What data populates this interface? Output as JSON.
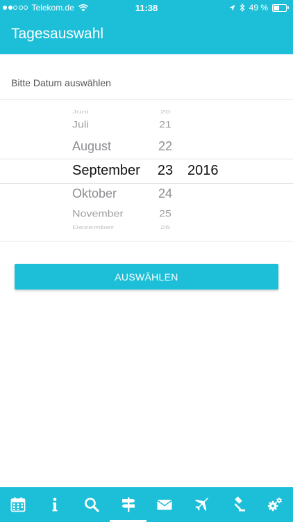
{
  "status_bar": {
    "carrier": "Telekom.de",
    "time": "11:38",
    "battery_text": "49 %",
    "battery_level": 0.49,
    "signal_strength": 2,
    "signal_max": 5
  },
  "nav": {
    "title": "Tagesauswahl"
  },
  "prompt": "Bitte Datum auswählen",
  "picker": {
    "months": [
      "Juni",
      "Juli",
      "August",
      "September",
      "Oktober",
      "November",
      "Dezember"
    ],
    "days": [
      "20",
      "21",
      "22",
      "23",
      "24",
      "25",
      "26"
    ],
    "year": "2016",
    "selected": {
      "month": "September",
      "day": "23",
      "year": "2016"
    }
  },
  "select_button": {
    "label": "AUSWÄHLEN"
  },
  "tab_bar": {
    "tabs": [
      {
        "icon": "calendar-icon",
        "active": false
      },
      {
        "icon": "info-icon",
        "active": false
      },
      {
        "icon": "search-icon",
        "active": false
      },
      {
        "icon": "signpost-icon",
        "active": true
      },
      {
        "icon": "envelope-icon",
        "active": false
      },
      {
        "icon": "airplane-icon",
        "active": false
      },
      {
        "icon": "gavel-icon",
        "active": false
      },
      {
        "icon": "gears-icon",
        "active": false
      }
    ]
  },
  "colors": {
    "accent": "#1dbfd8",
    "text_selected": "#111111",
    "text_faded": "#8e8e93"
  }
}
